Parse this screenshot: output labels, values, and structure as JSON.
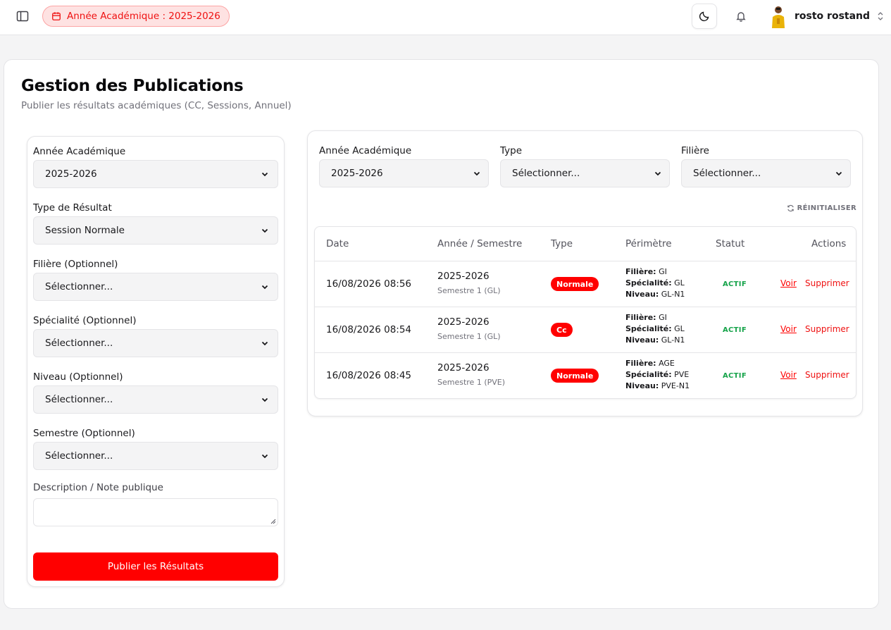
{
  "topbar": {
    "academic_year_pill": "Année Académique : 2025-2026",
    "user_name": "rosto rostand"
  },
  "page": {
    "title": "Gestion des Publications",
    "subtitle": "Publier les résultats académiques (CC, Sessions, Annuel)"
  },
  "form": {
    "fields": [
      {
        "label": "Année Académique",
        "value": "2025-2026"
      },
      {
        "label": "Type de Résultat",
        "value": "Session Normale"
      },
      {
        "label": "Filière (Optionnel)",
        "value": "Sélectionner..."
      },
      {
        "label": "Spécialité (Optionnel)",
        "value": "Sélectionner..."
      },
      {
        "label": "Niveau (Optionnel)",
        "value": "Sélectionner..."
      },
      {
        "label": "Semestre (Optionnel)",
        "value": "Sélectionner..."
      }
    ],
    "description_label": "Description / Note publique",
    "description_value": "",
    "publish_label": "Publier les Résultats"
  },
  "filters": {
    "year": {
      "label": "Année Académique",
      "value": "2025-2026"
    },
    "type": {
      "label": "Type",
      "value": "Sélectionner..."
    },
    "filiere": {
      "label": "Filière",
      "value": "Sélectionner..."
    },
    "reset_label": "RÉINITIALISER"
  },
  "table": {
    "headers": [
      "Date",
      "Année / Semestre",
      "Type",
      "Périmètre",
      "Statut",
      "Actions"
    ],
    "scope_labels": {
      "filiere": "Filière:",
      "specialite": "Spécialité:",
      "niveau": "Niveau:"
    },
    "rows": [
      {
        "date": "16/08/2026 08:56",
        "year": "2025-2026",
        "semester": "Semestre 1 (GL)",
        "type": "Normale",
        "filiere": "GI",
        "specialite": "GL",
        "niveau": "GL-N1",
        "status": "ACTIF",
        "view": "Voir",
        "delete": "Supprimer"
      },
      {
        "date": "16/08/2026 08:54",
        "year": "2025-2026",
        "semester": "Semestre 1 (GL)",
        "type": "Cc",
        "filiere": "GI",
        "specialite": "GL",
        "niveau": "GL-N1",
        "status": "ACTIF",
        "view": "Voir",
        "delete": "Supprimer"
      },
      {
        "date": "16/08/2026 08:45",
        "year": "2025-2026",
        "semester": "Semestre 1 (PVE)",
        "type": "Normale",
        "filiere": "AGE",
        "specialite": "PVE",
        "niveau": "PVE-N1",
        "status": "ACTIF",
        "view": "Voir",
        "delete": "Supprimer"
      }
    ]
  },
  "colors": {
    "accent": "#ff0000",
    "status_active": "#16a34a",
    "pill_bg": "#fee2e2"
  },
  "icons": [
    "sidebar-toggle-icon",
    "calendar-icon",
    "moon-icon",
    "bell-icon",
    "chevrons-updown-icon",
    "chevron-down-icon",
    "refresh-icon"
  ]
}
